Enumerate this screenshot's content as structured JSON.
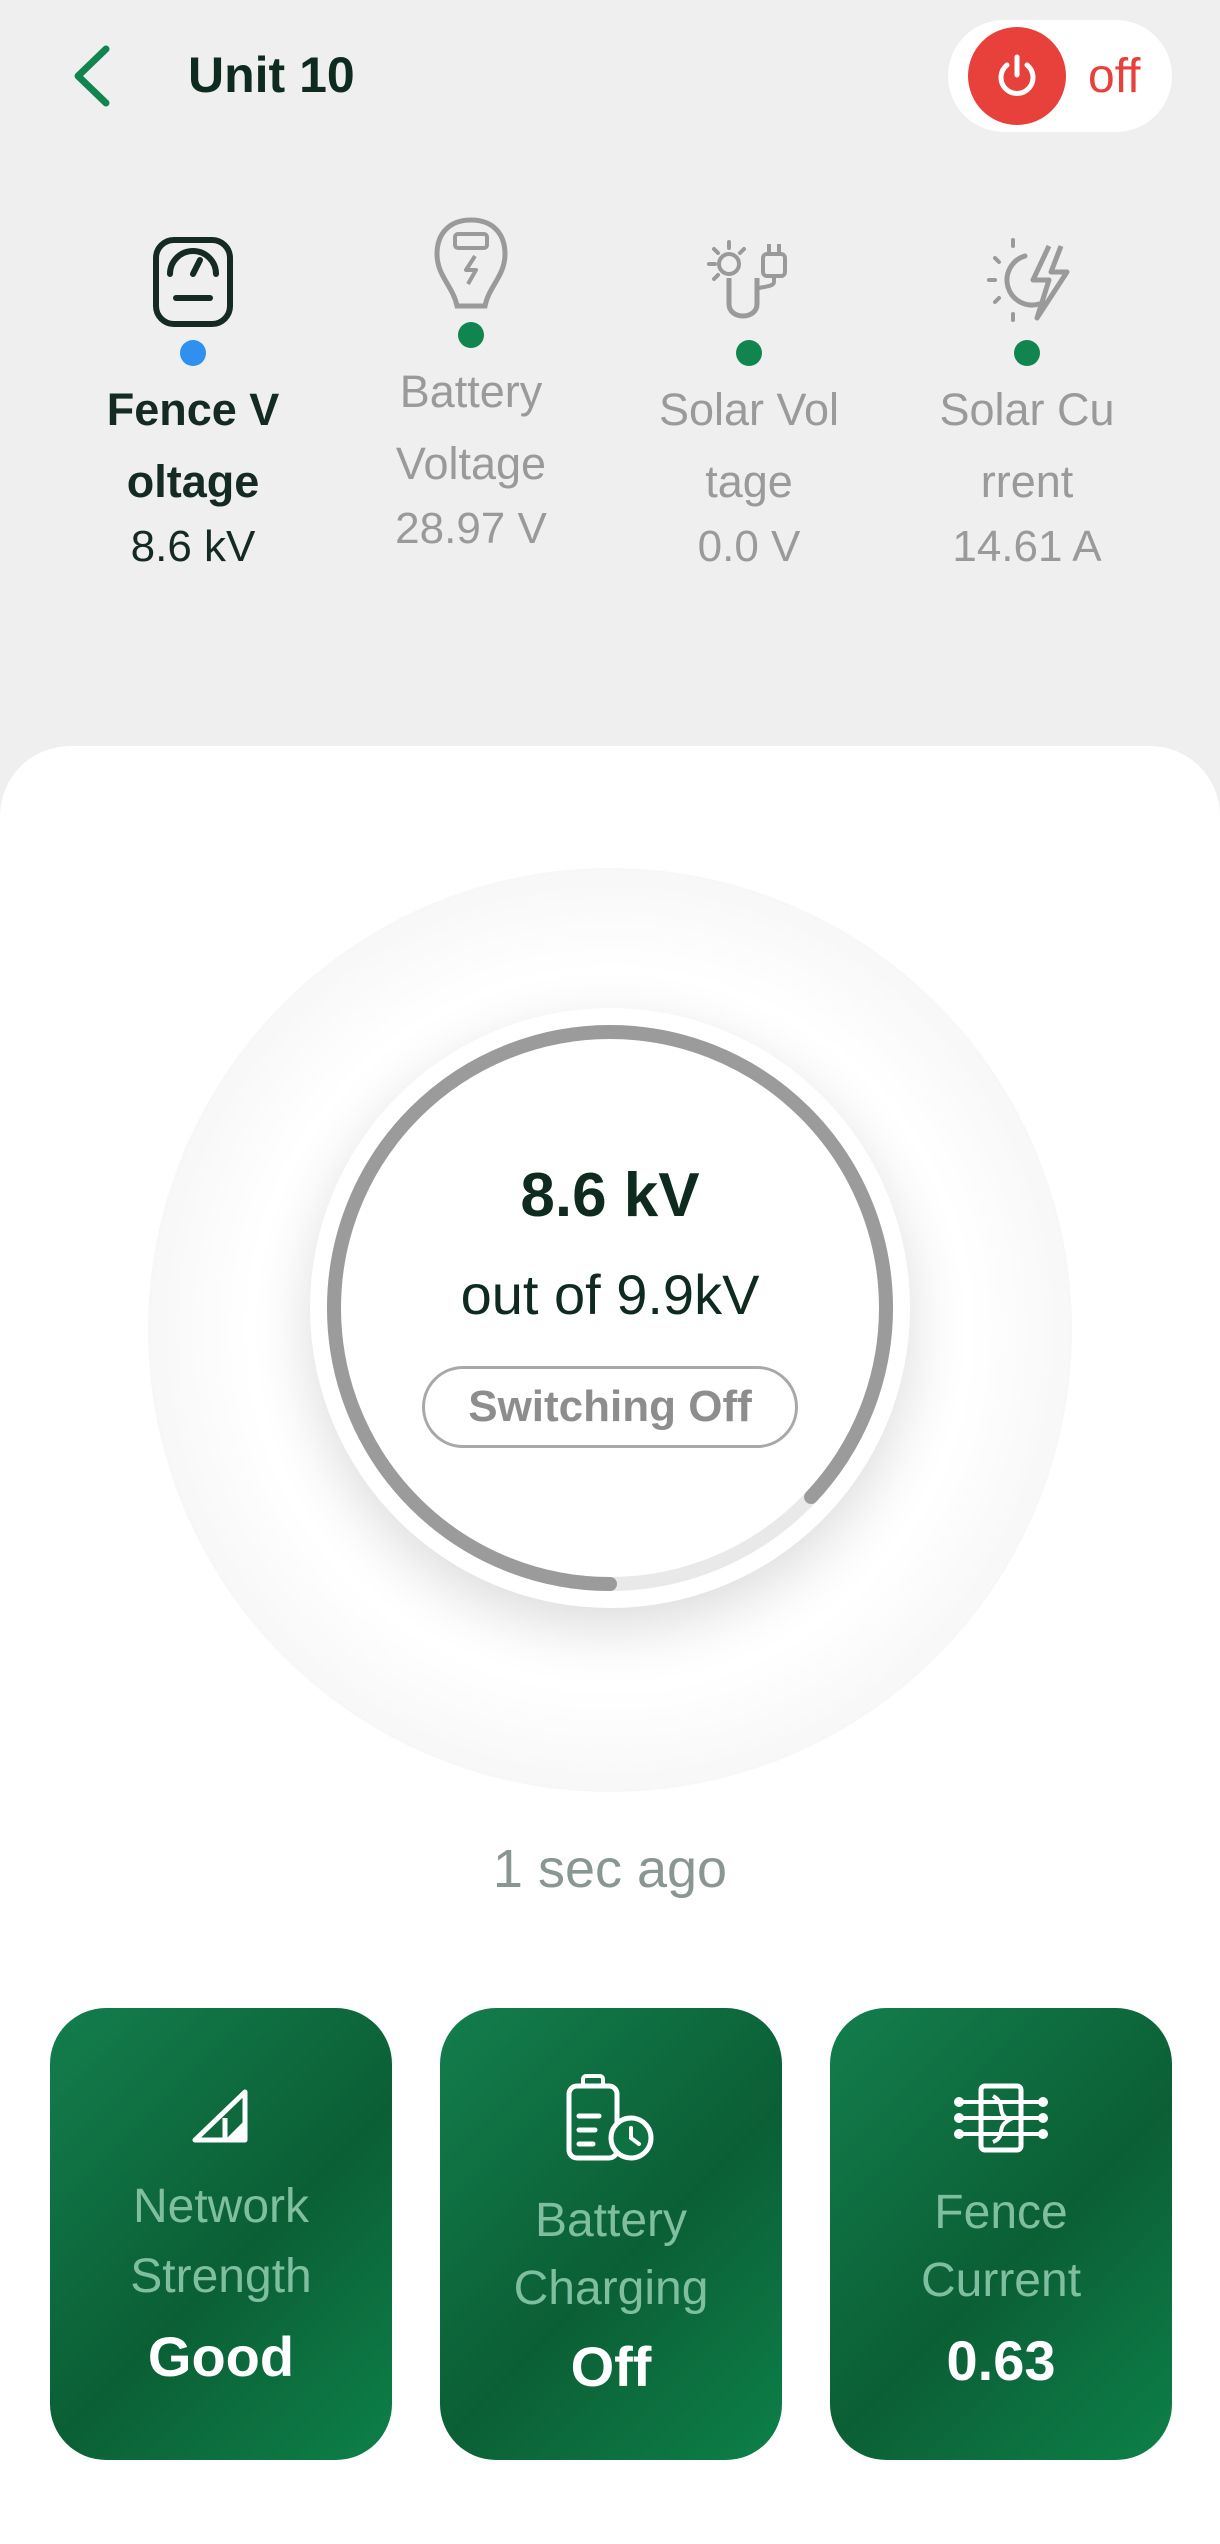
{
  "header": {
    "title": "Unit 10",
    "power_label": "off"
  },
  "stats": [
    {
      "label": "Fence Voltage",
      "value": "8.6 kV",
      "icon": "fence-gauge-icon",
      "dot_color": "#2f90ef"
    },
    {
      "label": "Battery Voltage",
      "value": "28.97 V",
      "icon": "battery-meter-icon",
      "dot_color": "#11854f"
    },
    {
      "label": "Solar Voltage",
      "value": "0.0 V",
      "icon": "solar-plug-icon",
      "dot_color": "#11854f"
    },
    {
      "label": "Solar Current",
      "value": "14.61 A",
      "icon": "solar-bolt-icon",
      "dot_color": "#11854f"
    }
  ],
  "gauge": {
    "value": "8.6 kV",
    "subtitle": "out of 9.9kV",
    "status": "Switching Off",
    "fraction": 0.87,
    "ring_color": "#9b9b9b",
    "track_color": "#e9e9e9"
  },
  "updated": "1 sec ago",
  "cards": [
    {
      "label_line1": "Network",
      "label_line2": "Strength",
      "value": "Good",
      "icon": "signal-icon"
    },
    {
      "label_line1": "Battery",
      "label_line2": "Charging",
      "value": "Off",
      "icon": "battery-timer-icon"
    },
    {
      "label_line1": "Fence",
      "label_line2": "Current",
      "value": "0.63",
      "icon": "fence-current-icon"
    }
  ],
  "colors": {
    "brand": "#0b6b3e",
    "accent_off": "#e8403a"
  }
}
